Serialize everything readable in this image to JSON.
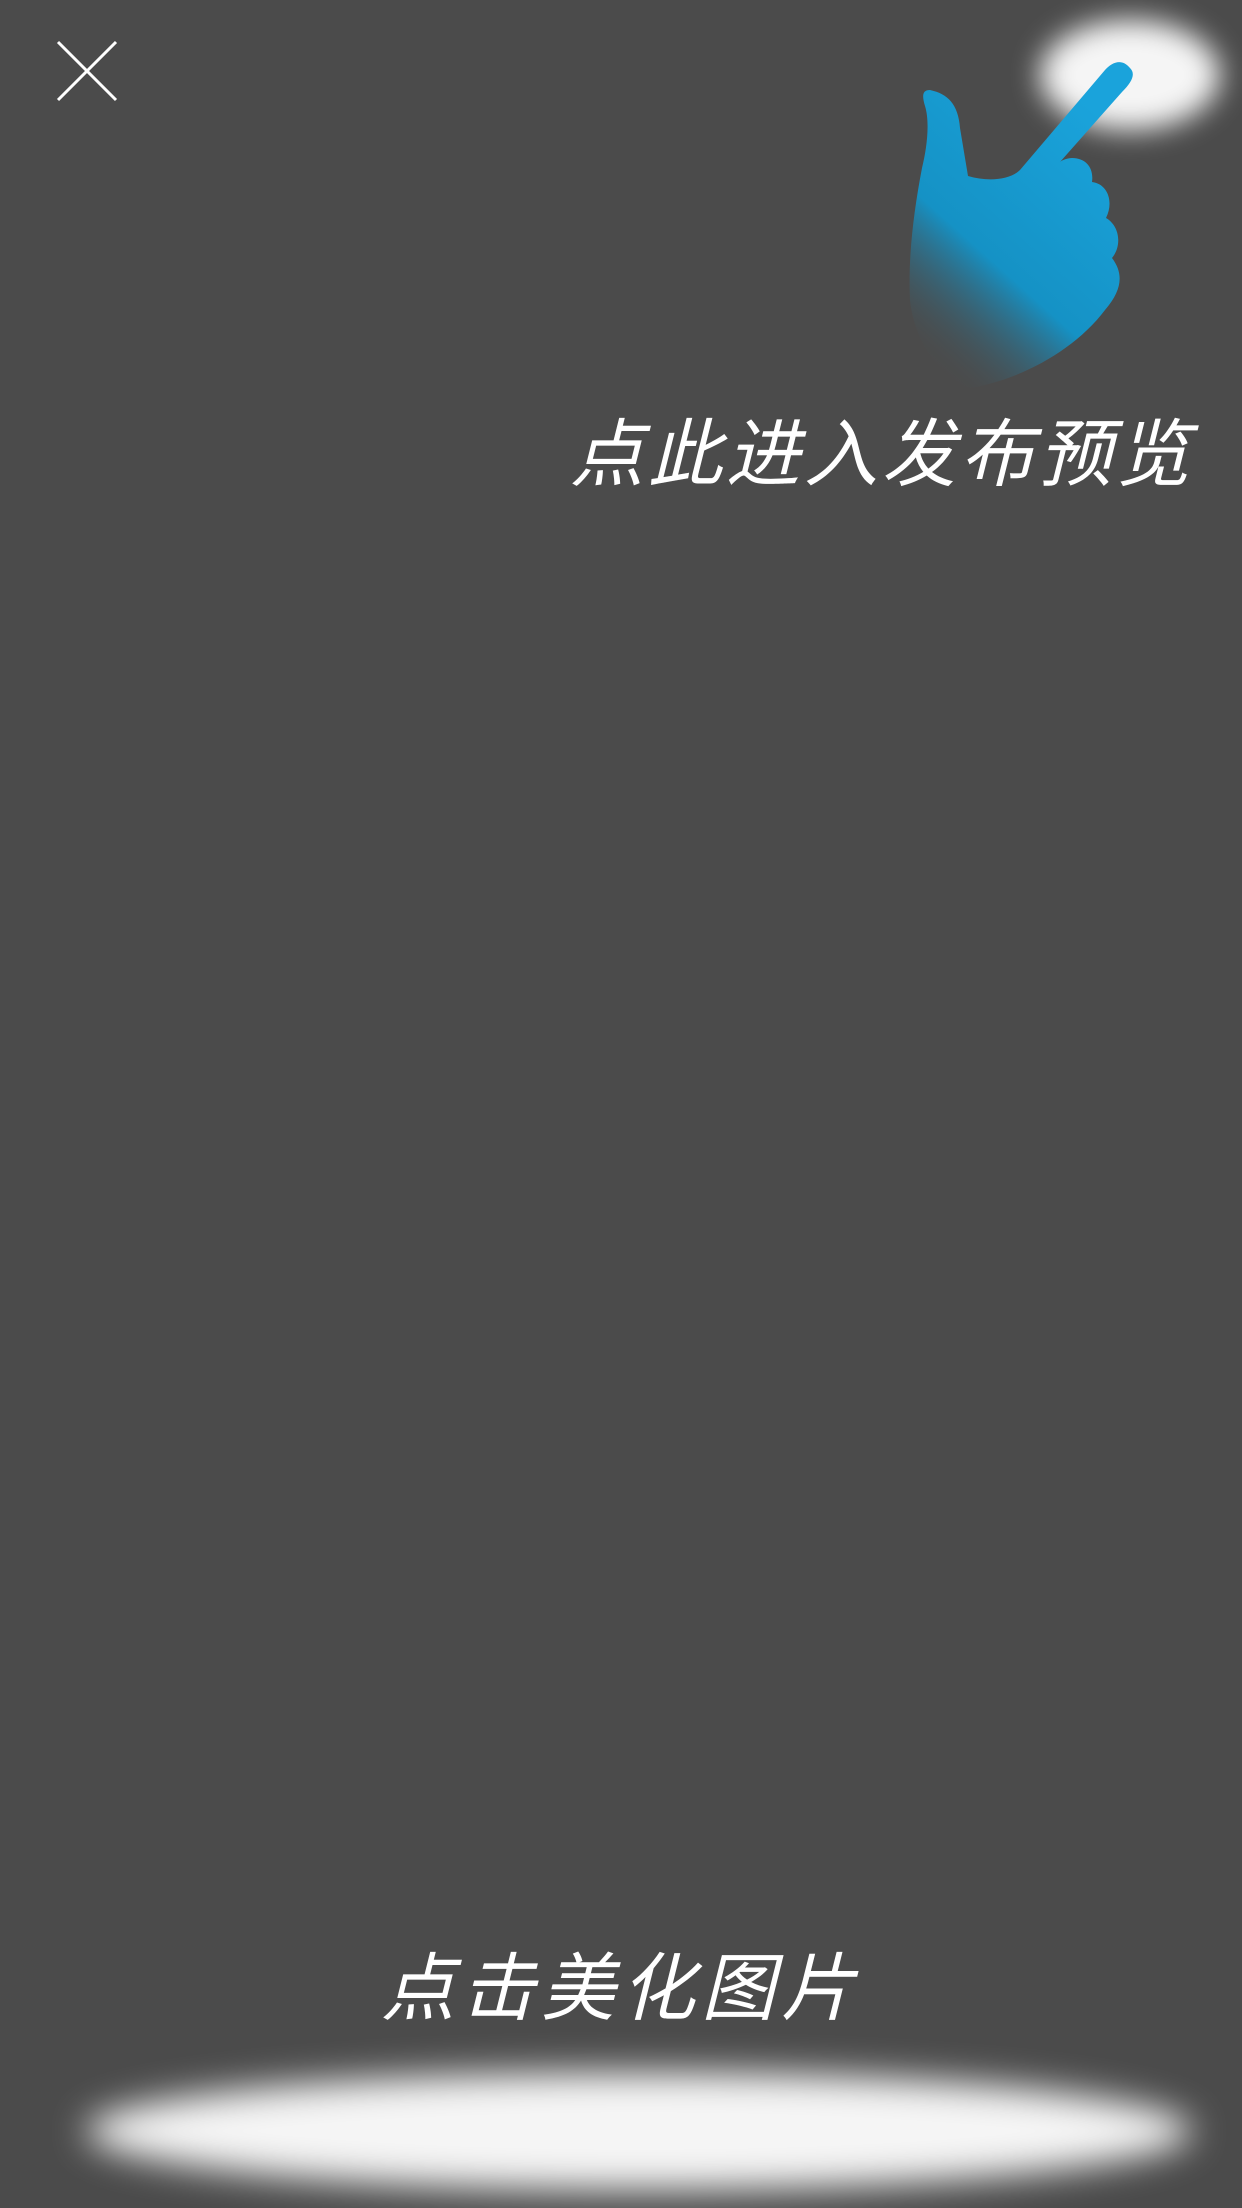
{
  "icons": {
    "close": "close-icon",
    "hand": "pointing-hand-icon"
  },
  "colors": {
    "overlay_background": "#4b4b4b",
    "text": "#ffffff",
    "hand": "#149bd1"
  },
  "hints": {
    "preview": "点此进入发布预览",
    "beautify": "点击美化图片"
  }
}
